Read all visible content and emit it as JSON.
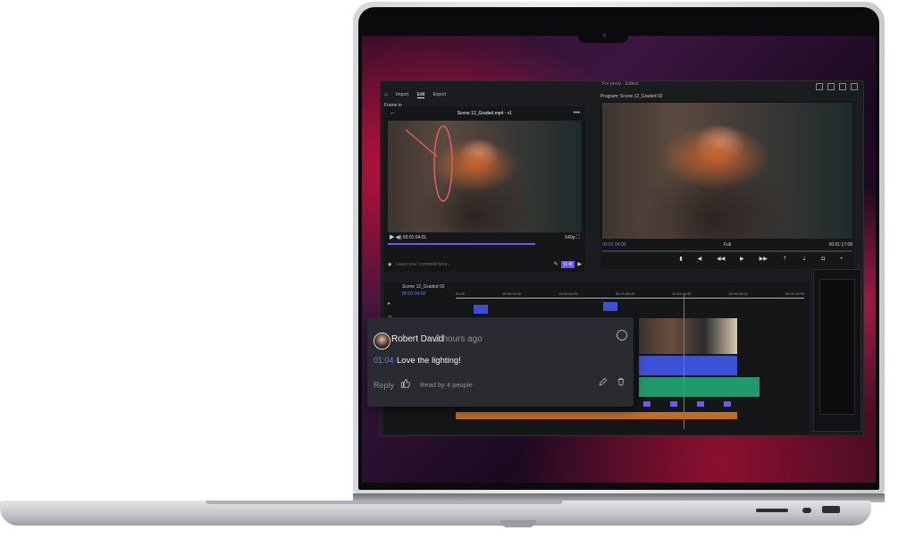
{
  "app": {
    "project_title": "For presy · Edited",
    "menu": [
      "Import",
      "Edit",
      "Export"
    ],
    "active_menu": "Edit",
    "source_panel_label": "Frame.io",
    "program_panel_label": "Program: Scene 12_Graded 02",
    "sequence_tab": "Scene 12_Graded 02"
  },
  "source": {
    "clip_title": "Scene 12_Graded.mp4 - v1",
    "timecode": "00:01:04:01",
    "quality": "540p",
    "comment_placeholder": "Leave your comment here...",
    "send_label": "[1:4]"
  },
  "program": {
    "timecode_left": "00:01:04:00",
    "fit_label": "Full",
    "timecode_right": "00:01:17:08"
  },
  "timeline": {
    "timecode": "00:01:04:00",
    "ruler": [
      "00:00",
      "00:00:02:00",
      "00:00:04:00",
      "00:00:06:00",
      "00:01:06:00",
      "00:00:08:00",
      "00:00:10:00"
    ]
  },
  "comment": {
    "author": "Robert David",
    "time_ago": "2 hours ago",
    "timecode": "01:04",
    "message": "Love the lighting!",
    "reply_label": "Reply",
    "read_by": "Read by 4 people"
  },
  "icons": {
    "like": "thumbs-up-icon",
    "edit": "pencil-icon",
    "delete": "trash-icon",
    "resolve": "circle-icon"
  },
  "colors": {
    "accent": "#6b5af0",
    "timecode": "#6f7ef2"
  }
}
